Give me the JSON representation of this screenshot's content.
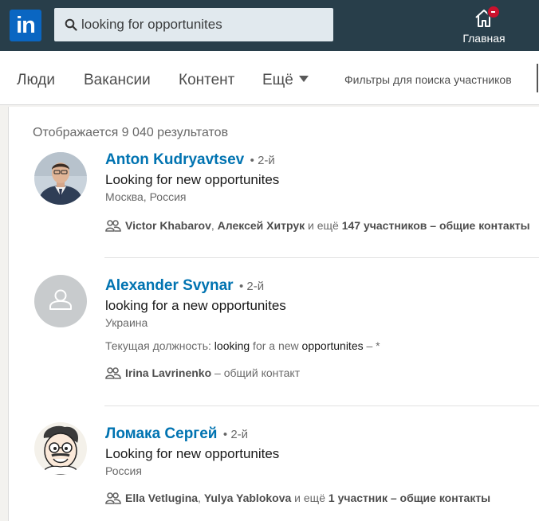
{
  "header": {
    "logo_text": "in",
    "search": {
      "value": "looking for opportunites"
    },
    "home_label": "Главная",
    "notification_count": "-"
  },
  "filters": {
    "tabs": [
      {
        "label": "Люди"
      },
      {
        "label": "Вакансии"
      },
      {
        "label": "Контент"
      },
      {
        "label": "Ещё"
      }
    ],
    "people_filters_link": "Фильтры для поиска участников"
  },
  "results": {
    "count_text": "Отображается 9 040 результатов",
    "items": [
      {
        "name": "Anton Kudryavtsev",
        "degree": "• 2-й",
        "headline": "Looking for new opportunites",
        "location": "Москва, Россия",
        "shared": {
          "name1": "Victor Khabarov",
          "sep": ", ",
          "name2": "Алексей Хитрук",
          "mid": " и ещё ",
          "more": "147 участников",
          "tail": " – общие контакты"
        }
      },
      {
        "name": "Alexander Svynar",
        "degree": "• 2-й",
        "headline": "looking for a new opportunites",
        "location": "Украина",
        "current": {
          "prefix": "Текущая должность: ",
          "w1": "looking",
          "t1": " for a new ",
          "w2": "opportunites",
          "t2": " – *"
        },
        "shared": {
          "name1": "Irina Lavrinenko",
          "tail": " – общий контакт"
        }
      },
      {
        "name": "Ломака Сергей",
        "degree": "• 2-й",
        "headline": "Looking for new opportunites",
        "location": "Россия",
        "shared": {
          "name1": "Ella Vetlugina",
          "sep": ", ",
          "name2": "Yulya Yablokova",
          "mid": " и ещё ",
          "more": "1 участник",
          "tail": " – общие контакты"
        }
      }
    ]
  },
  "colors": {
    "topbar": "#283e4a",
    "brand": "#0a66c2",
    "link": "#0073b1",
    "badge": "#cb112d"
  }
}
